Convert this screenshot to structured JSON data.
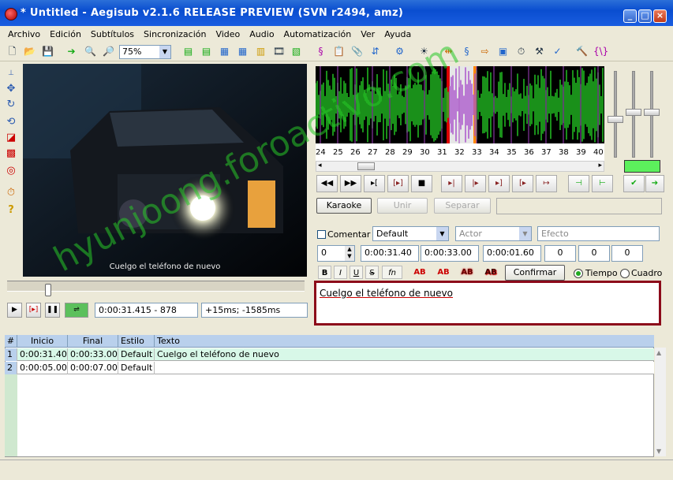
{
  "window": {
    "title": "* Untitled - Aegisub v2.1.6 RELEASE PREVIEW (SVN r2494, amz)"
  },
  "menu": [
    "Archivo",
    "Edición",
    "Subtítulos",
    "Sincronización",
    "Video",
    "Audio",
    "Automatización",
    "Ver",
    "Ayuda"
  ],
  "toolbar": {
    "zoom_value": "75%"
  },
  "video": {
    "subtitle_overlay": "Cuelgo el teléfono de nuevo",
    "time_display": "0:00:31.415 - 878",
    "offset_display": "+15ms; -1585ms"
  },
  "audio": {
    "ticks": [
      "24",
      "25",
      "26",
      "27",
      "28",
      "29",
      "30",
      "31",
      "32",
      "33",
      "34",
      "35",
      "36",
      "37",
      "38",
      "39",
      "40"
    ],
    "karaoke_label": "Karaoke",
    "join_label": "Unir",
    "split_label": "Separar"
  },
  "editor": {
    "comment_label": "Comentar",
    "style_value": "Default",
    "actor_placeholder": "Actor",
    "effect_placeholder": "Efecto",
    "layer_value": "0",
    "start_time": "0:00:31.40",
    "end_time": "0:00:33.00",
    "duration": "0:00:01.60",
    "margin_l": "0",
    "margin_r": "0",
    "margin_v": "0",
    "bold_label": "B",
    "italic_label": "I",
    "underline_label": "U",
    "strike_label": "S",
    "fn_label": "fn",
    "ab_label": "AB",
    "commit_label": "Confirmar",
    "time_radio": "Tiempo",
    "frame_radio": "Cuadro",
    "text": "Cuelgo el teléfono de nuevo"
  },
  "grid": {
    "headers": [
      "#",
      "Inicio",
      "Final",
      "Estilo",
      "Texto"
    ],
    "rows": [
      {
        "num": "1",
        "start": "0:00:31.40",
        "end": "0:00:33.00",
        "style": "Default",
        "text": "Cuelgo el teléfono de nuevo"
      },
      {
        "num": "2",
        "start": "0:00:05.00",
        "end": "0:00:07.00",
        "style": "Default",
        "text": ""
      }
    ]
  },
  "watermark": "hyunjoong.foroactivo.com",
  "colors": {
    "title_bar": "#0a4ed0",
    "waveform": "#22c022",
    "selection": "#8c0a1a",
    "grid_header": "#b9d0ec",
    "active_row": "#d8f8e8"
  }
}
